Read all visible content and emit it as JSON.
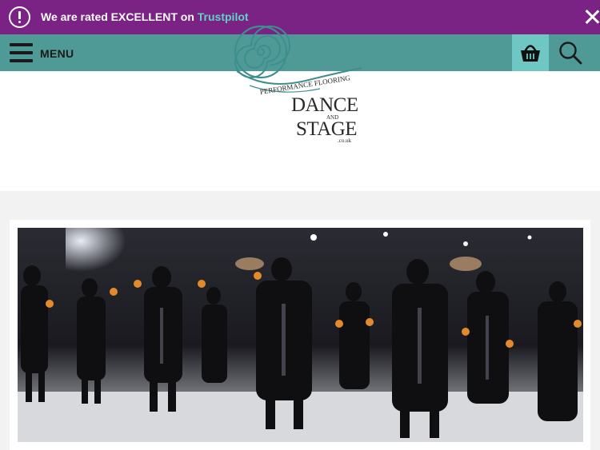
{
  "notice": {
    "text_prefix": "We are rated EXCELLENT on ",
    "text_link": "Trustpilot"
  },
  "nav": {
    "menu_label": "MENU"
  },
  "logo": {
    "line1": "DANCE",
    "and": "AND",
    "line2": "STAGE",
    "domain": ".co.uk",
    "tagline": "PERFORMANCE FLOORING"
  },
  "colors": {
    "notice_bg": "#7a2385",
    "trustpilot_link": "#5fd3c4",
    "nav_bg": "#4f9a97",
    "basket_bg": "#6fc7c4",
    "logo_teal": "#3d8f8e"
  },
  "hero": {
    "description": ""
  }
}
